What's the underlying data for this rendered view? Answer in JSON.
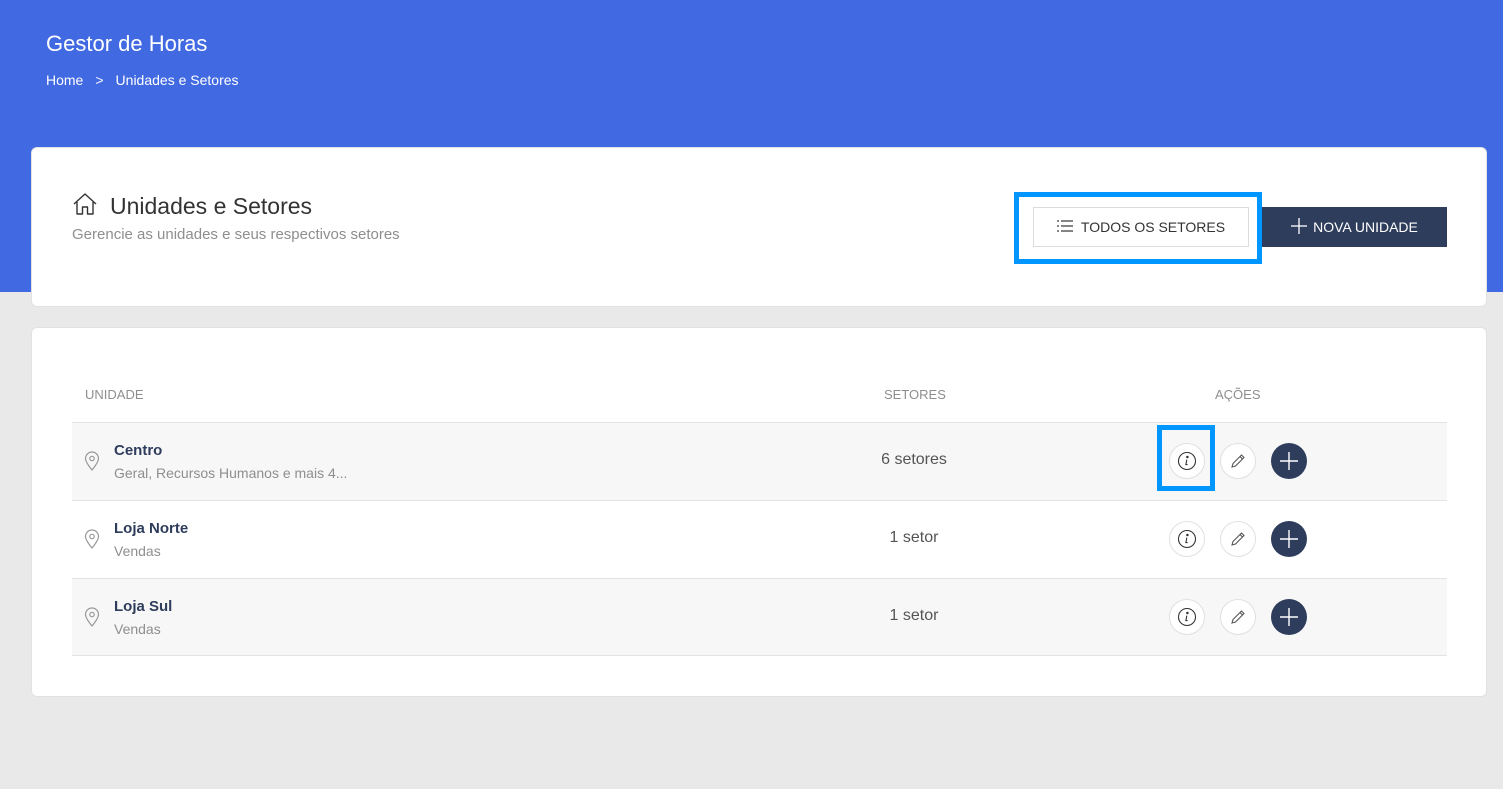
{
  "app": {
    "title": "Gestor de Horas"
  },
  "breadcrumb": {
    "home": "Home",
    "separator": ">",
    "current": "Unidades e Setores"
  },
  "page": {
    "title": "Unidades e Setores",
    "subtitle": "Gerencie as unidades e seus respectivos setores",
    "title_icon": "home-icon"
  },
  "toolbar": {
    "todos_label": "TODOS OS SETORES",
    "todos_icon": "list-icon",
    "nova_label": "NOVA UNIDADE",
    "nova_icon": "plus-icon"
  },
  "table": {
    "headers": {
      "unidade": "UNIDADE",
      "setores": "SETORES",
      "acoes": "AÇÕES"
    },
    "rows": [
      {
        "name": "Centro",
        "sub": "Geral, Recursos Humanos e mais 4...",
        "count": "6 setores"
      },
      {
        "name": "Loja Norte",
        "sub": "Vendas",
        "count": "1 setor"
      },
      {
        "name": "Loja Sul",
        "sub": "Vendas",
        "count": "1 setor"
      }
    ]
  },
  "colors": {
    "header_bg": "#4169e1",
    "primary_dark": "#2f3d5c",
    "highlight": "#0096ff",
    "page_bg": "#e9e9e9"
  }
}
